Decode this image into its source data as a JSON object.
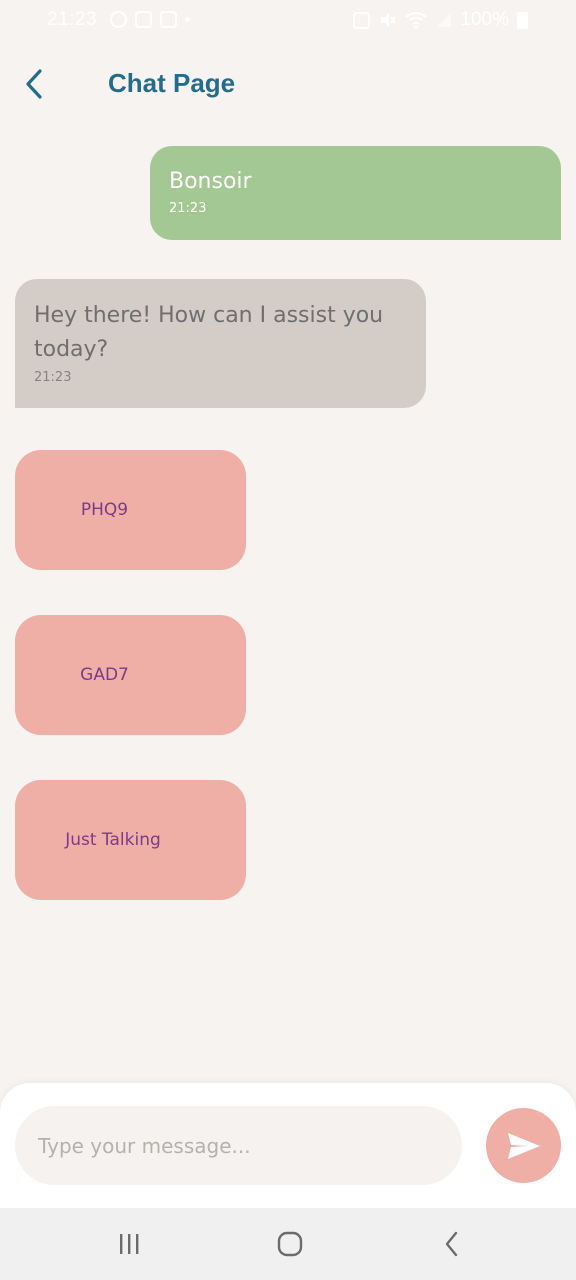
{
  "status_bar": {
    "time": "21:23",
    "battery": "100%"
  },
  "header": {
    "title": "Chat Page",
    "back_icon": "chevron-left-icon",
    "accent_color": "#236c8c"
  },
  "messages": [
    {
      "sender": "user",
      "text": "Bonsoir",
      "time": "21:23",
      "color": "#a4c893"
    },
    {
      "sender": "bot",
      "text": "Hey there! How can I assist you today?",
      "time": "21:23",
      "color": "#d4ccc7"
    }
  ],
  "options": [
    {
      "label": "PHQ9"
    },
    {
      "label": "GAD7"
    },
    {
      "label": "Just Talking"
    }
  ],
  "option_color": "#efaea6",
  "composer": {
    "placeholder": "Type your message...",
    "send_icon": "send-icon"
  },
  "nav_bar": {
    "recents_icon": "recents-icon",
    "home_icon": "home-icon",
    "back_icon": "back-icon"
  }
}
